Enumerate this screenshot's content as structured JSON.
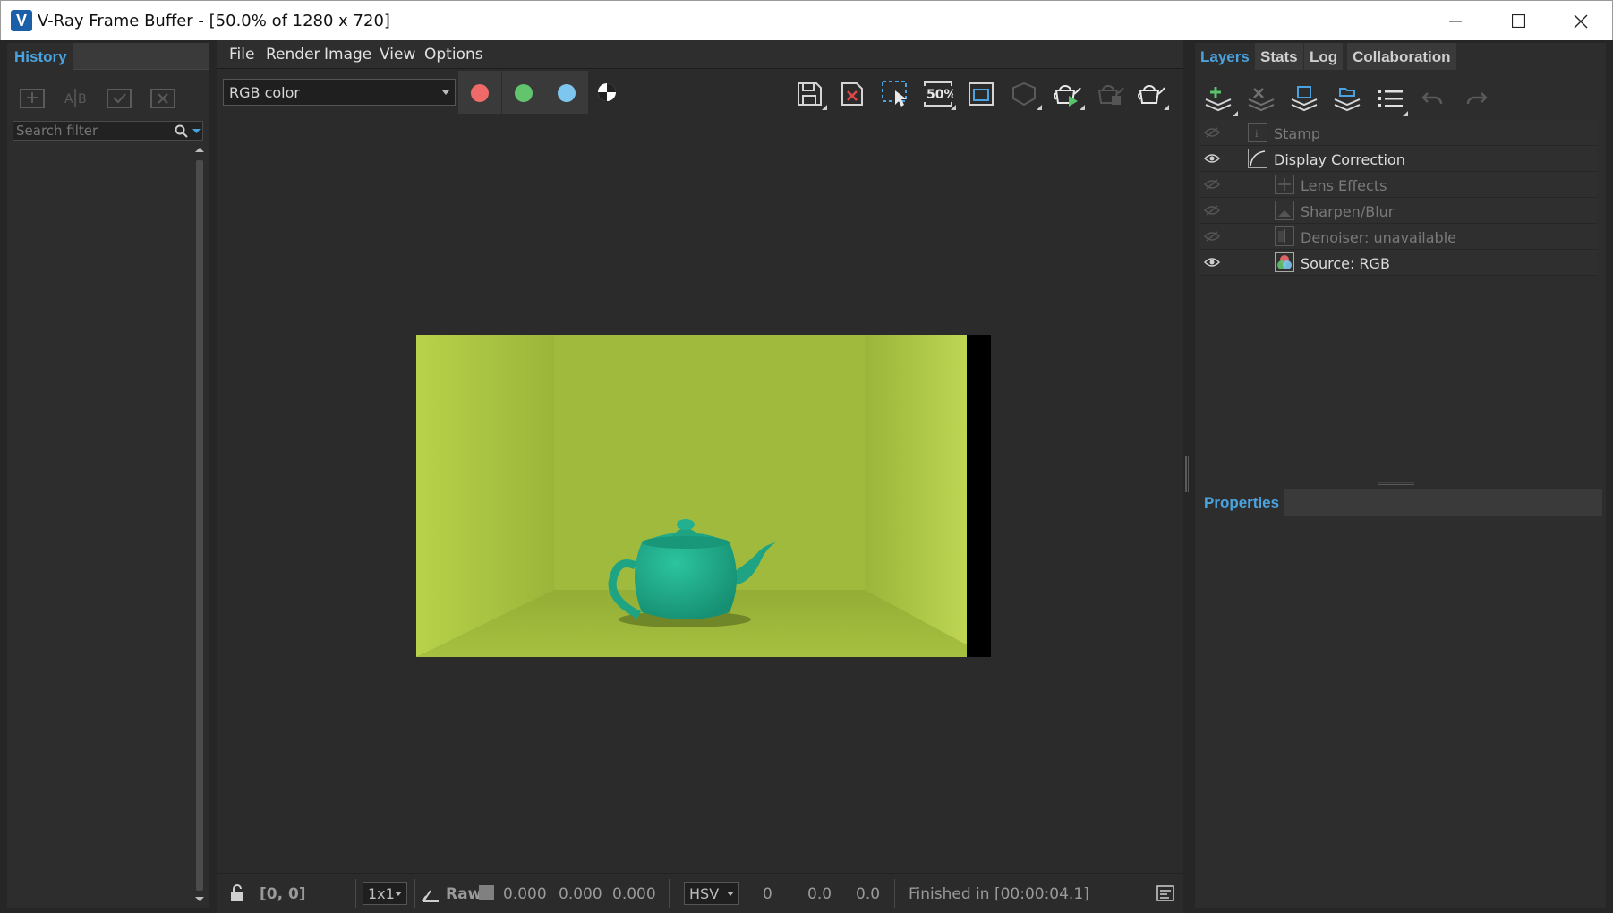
{
  "window": {
    "title": "V-Ray Frame Buffer - [50.0% of 1280 x 720]",
    "app_icon_letter": "V",
    "minimize_label": "—",
    "maximize_label": "☐",
    "close_label": "✕"
  },
  "history": {
    "tab_label": "History",
    "search_placeholder": "Search filter"
  },
  "menu": {
    "items": [
      "File",
      "Render",
      "Image",
      "View",
      "Options"
    ]
  },
  "toolbar": {
    "channel": "RGB color",
    "channel_colors": {
      "red": "#f06a6a",
      "green": "#62c46c",
      "blue": "#7cc6ef"
    },
    "zoom_label": "50%"
  },
  "status": {
    "coords": "[0, 0]",
    "sample_size": "1x1",
    "raw_label": "Raw",
    "r": "0.000",
    "g": "0.000",
    "b": "0.000",
    "color_mode": "HSV",
    "h": "0",
    "s": "0.0",
    "v": "0.0",
    "message": "Finished in [00:00:04.1]"
  },
  "right_panel": {
    "tabs": [
      "Layers",
      "Stats",
      "Log",
      "Collaboration"
    ],
    "layers": [
      {
        "name": "Stamp",
        "visible": false,
        "indent": 0,
        "icon": "stamp-icon"
      },
      {
        "name": "Display Correction",
        "visible": true,
        "indent": 0,
        "icon": "curve-icon"
      },
      {
        "name": "Lens Effects",
        "visible": false,
        "indent": 1,
        "icon": "lens-effects-icon"
      },
      {
        "name": "Sharpen/Blur",
        "visible": false,
        "indent": 1,
        "icon": "sharpen-icon"
      },
      {
        "name": "Denoiser: unavailable",
        "visible": false,
        "indent": 1,
        "icon": "denoiser-icon"
      },
      {
        "name": "Source: RGB",
        "visible": true,
        "indent": 1,
        "icon": "rgb-source-icon"
      }
    ],
    "properties_label": "Properties"
  },
  "colors": {
    "accent": "#4aa3df",
    "panel_bg": "#2d2d2d",
    "render_wall": "#9fb83c",
    "teapot": "#1fae8a"
  }
}
